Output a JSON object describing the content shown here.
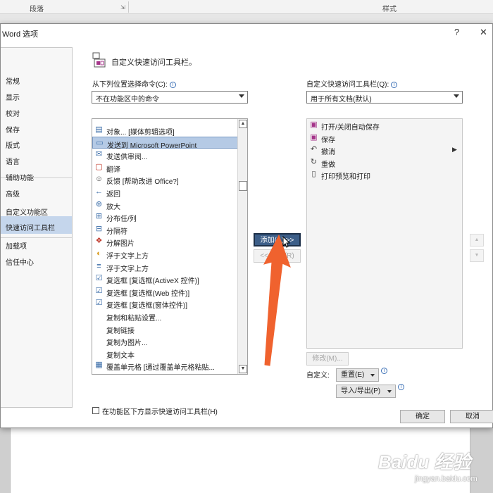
{
  "ribbon": {
    "group1": "段落",
    "group2": "样式"
  },
  "dialog": {
    "title": "Word 选项",
    "help": "?",
    "close": "✕"
  },
  "sidebar": {
    "items": [
      {
        "label": "常规"
      },
      {
        "label": "显示"
      },
      {
        "label": "校对"
      },
      {
        "label": "保存"
      },
      {
        "label": "版式"
      },
      {
        "label": "语言"
      },
      {
        "label": "辅助功能"
      },
      {
        "label": "高级"
      },
      {
        "label": "自定义功能区"
      },
      {
        "label": "快速访问工具栏"
      },
      {
        "label": "加载项"
      },
      {
        "label": "信任中心"
      }
    ],
    "selected": "快速访问工具栏"
  },
  "header": {
    "text": "自定义快速访问工具栏。"
  },
  "left": {
    "label": "从下列位置选择命令(C):",
    "combo": "不在功能区中的命令",
    "commands": [
      {
        "text": "对象... [媒体剪辑选项]",
        "icon": "object-icon"
      },
      {
        "text": "发送到 Microsoft PowerPoint",
        "icon": "powerpoint-icon",
        "selected": true
      },
      {
        "text": "发送供审阅...",
        "icon": "send-review-icon"
      },
      {
        "text": "翻译",
        "icon": "translate-icon"
      },
      {
        "text": "反馈 [帮助改进 Office?]",
        "icon": "feedback-icon"
      },
      {
        "text": "返回",
        "icon": "back-arrow-icon"
      },
      {
        "text": "放大",
        "icon": "zoom-icon"
      },
      {
        "text": "分布任/列",
        "icon": "distribute-icon"
      },
      {
        "text": "分隔符",
        "icon": "separator-icon"
      },
      {
        "text": "分解图片",
        "icon": "ungroup-picture-icon"
      },
      {
        "text": "浮于文字上方",
        "icon": "float-front-icon"
      },
      {
        "text": "浮于文字上方",
        "icon": "float-text-icon"
      },
      {
        "text": "复选框 [复选框(ActiveX 控件)]",
        "icon": "checkbox-icon"
      },
      {
        "text": "复选框 [复选框(Web 控件)]",
        "icon": "checkbox-icon"
      },
      {
        "text": "复选框 [复选框(窗体控件)]",
        "icon": "checkbox-icon"
      },
      {
        "text": "复制和粘贴设置...",
        "icon": ""
      },
      {
        "text": "复制链接",
        "icon": ""
      },
      {
        "text": "复制为图片...",
        "icon": ""
      },
      {
        "text": "复制文本",
        "icon": ""
      },
      {
        "text": "覆盖单元格 [通过覆盖单元格粘贴...",
        "icon": "overwrite-cells-icon"
      }
    ],
    "checkbox_label": "在功能区下方显示快速访问工具栏(H)"
  },
  "middle": {
    "add": "添加(A) >>",
    "remove": "<< 删除(R)"
  },
  "right": {
    "label": "自定义快速访问工具栏(Q):",
    "combo": "用于所有文档(默认)",
    "items": [
      {
        "text": "打开/关闭自动保存",
        "icon": "autosave-icon"
      },
      {
        "text": "保存",
        "icon": "save-icon"
      },
      {
        "text": "撤消",
        "icon": "undo-icon"
      },
      {
        "text": "重做",
        "icon": "redo-icon"
      },
      {
        "text": "打印预览和打印",
        "icon": "print-preview-icon"
      }
    ],
    "modify": "修改(M)...",
    "customize_label": "自定义:",
    "reset": "重置(E)",
    "import_export": "导入/导出(P)"
  },
  "footer": {
    "ok": "确定",
    "cancel": "取消"
  },
  "watermark": {
    "brand": "Baidu 经验",
    "url": "jingyan.baidu.com"
  }
}
